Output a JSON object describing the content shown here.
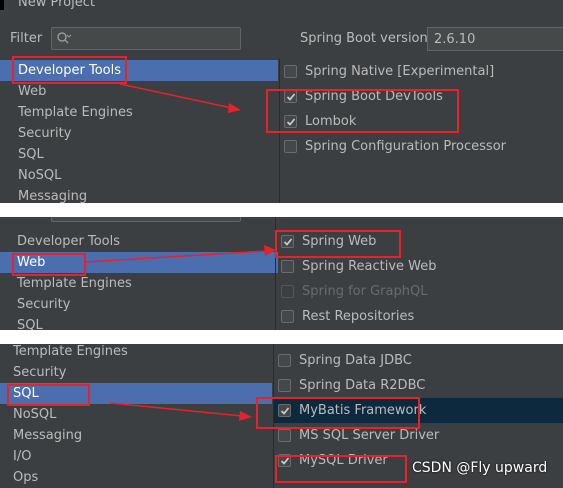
{
  "panel1": {
    "window_title": "New Project",
    "filter_label": "Filter",
    "spring_boot_version_label": "Spring Boot version",
    "spring_boot_version_value": "2.6.10",
    "categories": [
      {
        "label": "Developer Tools",
        "selected": true
      },
      {
        "label": "Web",
        "selected": false
      },
      {
        "label": "Template Engines",
        "selected": false
      },
      {
        "label": "Security",
        "selected": false
      },
      {
        "label": "SQL",
        "selected": false
      },
      {
        "label": "NoSQL",
        "selected": false
      },
      {
        "label": "Messaging",
        "selected": false
      }
    ],
    "dependencies": [
      {
        "label": "Spring Native [Experimental]",
        "checked": false
      },
      {
        "label": "Spring Boot DevTools",
        "checked": true
      },
      {
        "label": "Lombok",
        "checked": true
      },
      {
        "label": "Spring Configuration Processor",
        "checked": false
      }
    ]
  },
  "panel2": {
    "categories": [
      {
        "label": "Developer Tools",
        "selected": false
      },
      {
        "label": "Web",
        "selected": true
      },
      {
        "label": "Template Engines",
        "selected": false
      },
      {
        "label": "Security",
        "selected": false
      },
      {
        "label": "SQL",
        "selected": false
      }
    ],
    "dependencies": [
      {
        "label": "Spring Web",
        "checked": true,
        "disabled": false
      },
      {
        "label": "Spring Reactive Web",
        "checked": false,
        "disabled": false
      },
      {
        "label": "Spring for GraphQL",
        "checked": false,
        "disabled": true
      },
      {
        "label": "Rest Repositories",
        "checked": false,
        "disabled": false
      }
    ]
  },
  "panel3": {
    "categories": [
      {
        "label": "Template Engines",
        "selected": false
      },
      {
        "label": "Security",
        "selected": false
      },
      {
        "label": "SQL",
        "selected": true
      },
      {
        "label": "NoSQL",
        "selected": false
      },
      {
        "label": "Messaging",
        "selected": false
      },
      {
        "label": "I/O",
        "selected": false
      },
      {
        "label": "Ops",
        "selected": false
      }
    ],
    "dependencies": [
      {
        "label": "Spring Data JDBC",
        "checked": false,
        "highlighted": false
      },
      {
        "label": "Spring Data R2DBC",
        "checked": false,
        "highlighted": false
      },
      {
        "label": "MyBatis Framework",
        "checked": true,
        "highlighted": true
      },
      {
        "label": "MS SQL Server Driver",
        "checked": false,
        "highlighted": false
      },
      {
        "label": "MySQL Driver",
        "checked": true,
        "highlighted": false
      }
    ]
  },
  "watermark": "CSDN @Fly upward",
  "colors": {
    "background": "#3c3f41",
    "selection": "#4b6eaf",
    "highlight_row": "#0d293e",
    "annotation": "#e8212b"
  },
  "icons": {
    "filter_search": "search-icon",
    "checkbox_check": "check-icon",
    "annotation_arrow": "arrow-icon"
  }
}
